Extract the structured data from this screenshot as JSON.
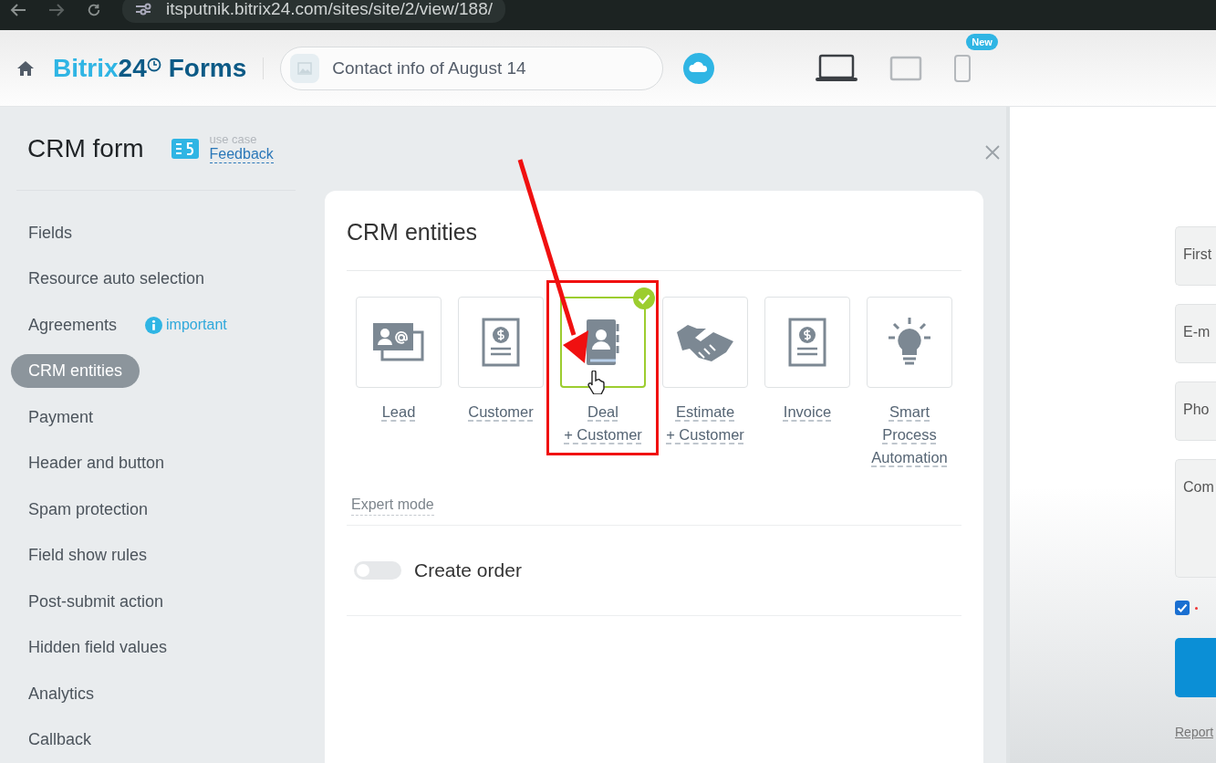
{
  "browser": {
    "url": "itsputnik.bitrix24.com/sites/site/2/view/188/"
  },
  "header": {
    "logo_light": "Bitrix",
    "logo_dark": "24",
    "logo_product": "Forms",
    "form_name": "Contact info of August 14",
    "devices": [
      {
        "kind": "laptop",
        "selected": true
      },
      {
        "kind": "tablet",
        "selected": false
      },
      {
        "kind": "phone",
        "selected": false,
        "badge": "New"
      }
    ]
  },
  "panel": {
    "title": "CRM form",
    "use_case_label": "use case",
    "use_case": "Feedback"
  },
  "sidebar": {
    "items": [
      {
        "label": "Fields",
        "selected": false
      },
      {
        "label": "Resource auto selection",
        "selected": false
      },
      {
        "label": "Agreements",
        "selected": false,
        "badge": "important"
      },
      {
        "label": "CRM entities",
        "selected": true
      },
      {
        "label": "Payment",
        "selected": false
      },
      {
        "label": "Header and button",
        "selected": false
      },
      {
        "label": "Spam protection",
        "selected": false
      },
      {
        "label": "Field show rules",
        "selected": false
      },
      {
        "label": "Post-submit action",
        "selected": false
      },
      {
        "label": "Hidden field values",
        "selected": false
      },
      {
        "label": "Analytics",
        "selected": false
      },
      {
        "label": "Callback",
        "selected": false
      }
    ]
  },
  "card": {
    "title": "CRM entities",
    "entities": [
      {
        "label": "Lead",
        "selected": false
      },
      {
        "label": "Customer",
        "selected": false
      },
      {
        "label": "Deal\n+ Customer",
        "selected": true
      },
      {
        "label": "Estimate\n+ Customer",
        "selected": false
      },
      {
        "label": "Invoice",
        "selected": false
      },
      {
        "label": "Smart\nProcess\nAutomation",
        "selected": false
      }
    ],
    "expert_mode": "Expert mode",
    "toggle": {
      "label": "Create order",
      "on": false
    }
  },
  "preview": {
    "fields": [
      {
        "kind": "input",
        "placeholder": "First"
      },
      {
        "kind": "input",
        "placeholder": "E-m"
      },
      {
        "kind": "input",
        "placeholder": "Pho"
      },
      {
        "kind": "textarea",
        "placeholder": "Com"
      }
    ],
    "agreement": {
      "checked": true
    },
    "report": "Report"
  }
}
